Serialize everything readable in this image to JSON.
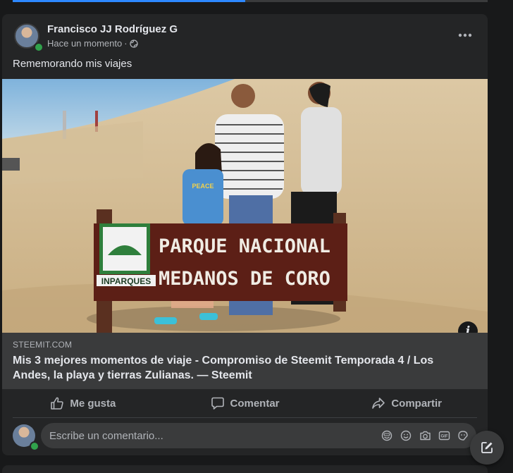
{
  "post": {
    "author": "Francisco JJ Rodríguez G",
    "time": "Hace un momento",
    "time_separator": "·",
    "text": "Rememorando mis viajes"
  },
  "photo": {
    "sign_line1": "PARQUE NACIONAL",
    "sign_line2": "MEDANOS DE CORO",
    "logo_text": "INPARQUES",
    "shirt_text": "PEACE"
  },
  "link": {
    "domain": "STEEMIT.COM",
    "title": "Mis 3 mejores momentos de viaje - Compromiso de Steemit Temporada 4 / Los Andes, la playa y tierras Zulianas. — Steemit",
    "info_glyph": "i"
  },
  "actions": {
    "like": "Me gusta",
    "comment": "Comentar",
    "share": "Compartir"
  },
  "comment": {
    "placeholder": "Escribe un comentario..."
  },
  "colors": {
    "accent": "#2d88ff",
    "online": "#31a24c",
    "card_bg": "#242526",
    "page_bg": "#18191a"
  },
  "icons": [
    "globe-icon",
    "more-icon",
    "info-icon",
    "like-icon",
    "comment-icon",
    "share-icon",
    "avatar-icon",
    "emoji-icon",
    "camera-icon",
    "gif-icon",
    "sticker-icon",
    "compose-icon"
  ]
}
